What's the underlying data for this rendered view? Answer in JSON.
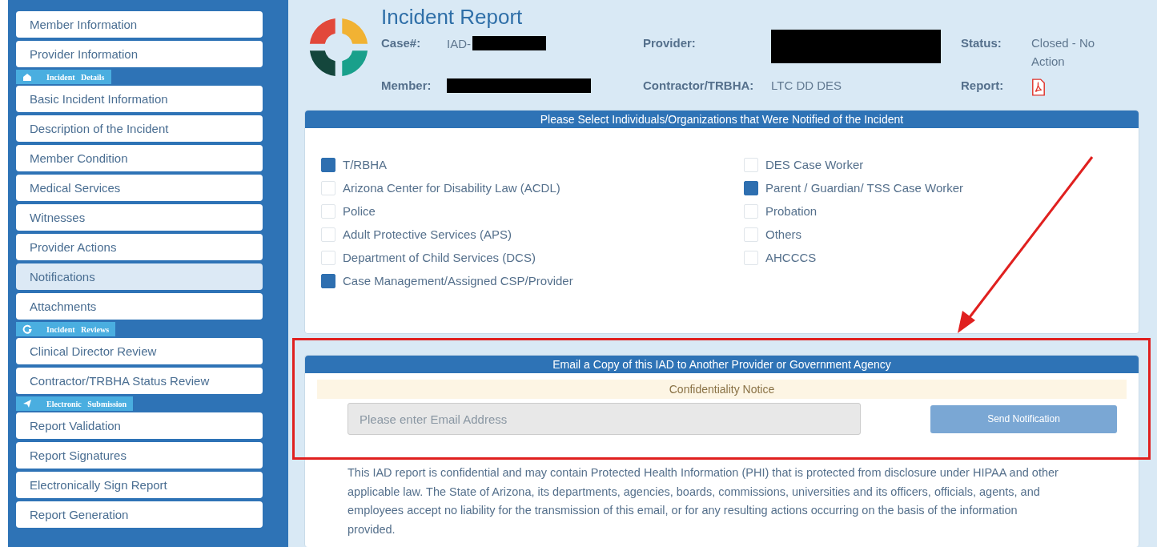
{
  "sidebar": {
    "items": [
      {
        "kind": "item",
        "label": "Member Information",
        "selected": false
      },
      {
        "kind": "item",
        "label": "Provider Information",
        "selected": false
      },
      {
        "kind": "header",
        "label": "Incident Details"
      },
      {
        "kind": "item",
        "label": "Basic Incident Information",
        "selected": false
      },
      {
        "kind": "item",
        "label": "Description of the Incident",
        "selected": false
      },
      {
        "kind": "item",
        "label": "Member Condition",
        "selected": false
      },
      {
        "kind": "item",
        "label": "Medical Services",
        "selected": false
      },
      {
        "kind": "item",
        "label": "Witnesses",
        "selected": false
      },
      {
        "kind": "item",
        "label": "Provider Actions",
        "selected": false
      },
      {
        "kind": "item",
        "label": "Notifications",
        "selected": true
      },
      {
        "kind": "item",
        "label": "Attachments",
        "selected": false
      },
      {
        "kind": "header",
        "label": "Incident Reviews"
      },
      {
        "kind": "item",
        "label": "Clinical Director Review",
        "selected": false
      },
      {
        "kind": "item",
        "label": "Contractor/TRBHA Status Review",
        "selected": false
      },
      {
        "kind": "header",
        "label": "Electronic Submission"
      },
      {
        "kind": "item",
        "label": "Report Validation",
        "selected": false
      },
      {
        "kind": "item",
        "label": "Report Signatures",
        "selected": false
      },
      {
        "kind": "item",
        "label": "Electronically Sign Report",
        "selected": false
      },
      {
        "kind": "item",
        "label": "Report Generation",
        "selected": false
      }
    ]
  },
  "header": {
    "title": "Incident Report",
    "case_label": "Case#:",
    "case_value": "IAD-",
    "member_label": "Member:",
    "provider_label": "Provider:",
    "contractor_label": "Contractor/TRBHA:",
    "contractor_value": "LTC DD DES",
    "status_label": "Status:",
    "status_value": "Closed - No Action",
    "report_label": "Report:"
  },
  "notified_panel": {
    "title": "Please Select Individuals/Organizations that Were Notified of the Incident",
    "left": [
      {
        "label": "T/RBHA",
        "checked": true
      },
      {
        "label": "Arizona Center for Disability Law (ACDL)",
        "checked": false
      },
      {
        "label": "Police",
        "checked": false
      },
      {
        "label": "Adult Protective Services (APS)",
        "checked": false
      },
      {
        "label": "Department of Child Services (DCS)",
        "checked": false
      },
      {
        "label": "Case Management/Assigned CSP/Provider",
        "checked": true
      }
    ],
    "right": [
      {
        "label": "DES Case Worker",
        "checked": false
      },
      {
        "label": "Parent / Guardian/ TSS Case Worker",
        "checked": true
      },
      {
        "label": "Probation",
        "checked": false
      },
      {
        "label": "Others",
        "checked": false
      },
      {
        "label": "AHCCCS",
        "checked": false
      }
    ]
  },
  "email_panel": {
    "title": "Email a Copy of this IAD to Another Provider or Government Agency",
    "notice": "Confidentiality Notice",
    "email": {
      "placeholder": "Please enter Email Address"
    },
    "send_button": "Send Notification",
    "disclaimer": "This IAD report is confidential and may contain Protected Health Information (PHI) that is protected from disclosure under HIPAA and other applicable law. The State of Arizona, its departments, agencies, boards, commissions, universities and its officers, officials, agents, and employees accept no liability for the transmission of this email, or for any resulting actions occurring on the basis of the information provided."
  }
}
